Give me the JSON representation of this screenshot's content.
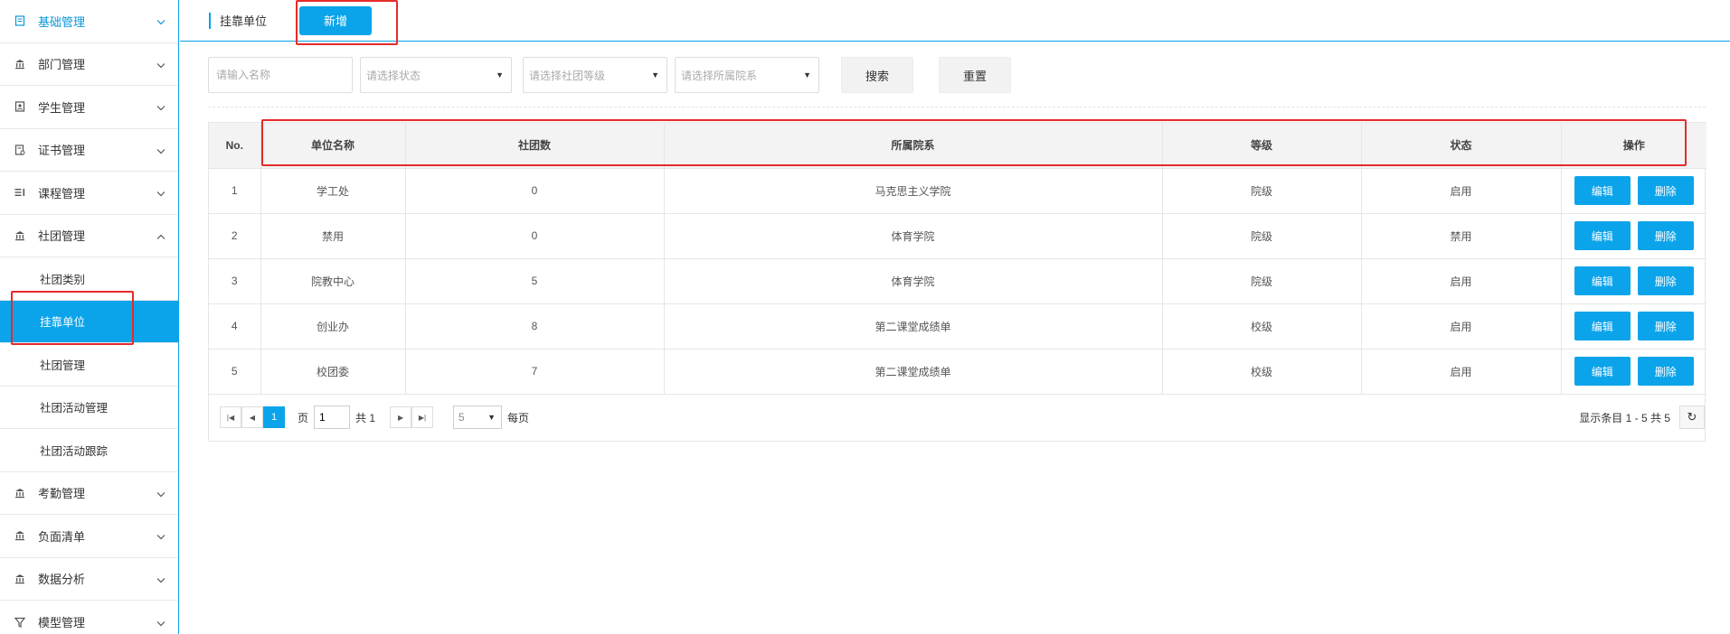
{
  "sidebar": {
    "items": [
      {
        "label": "基础管理",
        "icon": "doc-icon",
        "active": true
      },
      {
        "label": "部门管理",
        "icon": "building-icon"
      },
      {
        "label": "学生管理",
        "icon": "student-icon"
      },
      {
        "label": "证书管理",
        "icon": "certificate-icon"
      },
      {
        "label": "课程管理",
        "icon": "list-icon"
      },
      {
        "label": "社团管理",
        "icon": "building-icon",
        "expanded": true
      }
    ],
    "sub_items": [
      {
        "label": "社团类别"
      },
      {
        "label": "挂靠单位",
        "selected": true
      },
      {
        "label": "社团管理"
      },
      {
        "label": "社团活动管理"
      },
      {
        "label": "社团活动跟踪"
      }
    ],
    "items_after": [
      {
        "label": "考勤管理",
        "icon": "building-icon"
      },
      {
        "label": "负面清单",
        "icon": "building-icon"
      },
      {
        "label": "数据分析",
        "icon": "building-icon"
      },
      {
        "label": "模型管理",
        "icon": "funnel-icon"
      }
    ]
  },
  "header": {
    "breadcrumb": "挂靠单位",
    "add_label": "新增"
  },
  "filters": {
    "name_placeholder": "请输入名称",
    "status_placeholder": "请选择状态",
    "level_placeholder": "请选择社团等级",
    "college_placeholder": "请选择所属院系",
    "search_label": "搜索",
    "reset_label": "重置"
  },
  "table": {
    "headers": [
      "No.",
      "单位名称",
      "社团数",
      "所属院系",
      "等级",
      "状态",
      "操作"
    ],
    "rows": [
      {
        "no": "1",
        "name": "学工处",
        "count": "0",
        "college": "马克思主义学院",
        "level": "院级",
        "status": "启用"
      },
      {
        "no": "2",
        "name": "禁用",
        "count": "0",
        "college": "体育学院",
        "level": "院级",
        "status": "禁用"
      },
      {
        "no": "3",
        "name": "院教中心",
        "count": "5",
        "college": "体育学院",
        "level": "院级",
        "status": "启用"
      },
      {
        "no": "4",
        "name": "创业办",
        "count": "8",
        "college": "第二课堂成绩单",
        "level": "校级",
        "status": "启用"
      },
      {
        "no": "5",
        "name": "校团委",
        "count": "7",
        "college": "第二课堂成绩单",
        "level": "校级",
        "status": "启用"
      }
    ],
    "edit_label": "编辑",
    "delete_label": "删除"
  },
  "pager": {
    "current_page": "1",
    "page_label": "页",
    "page_input": "1",
    "total_label": "共 1",
    "page_size": "5",
    "per_page_label": "每页",
    "info": "显示条目 1 - 5 共 5"
  },
  "colors": {
    "accent": "#0ba4ea",
    "annotation": "#e52b2b"
  }
}
